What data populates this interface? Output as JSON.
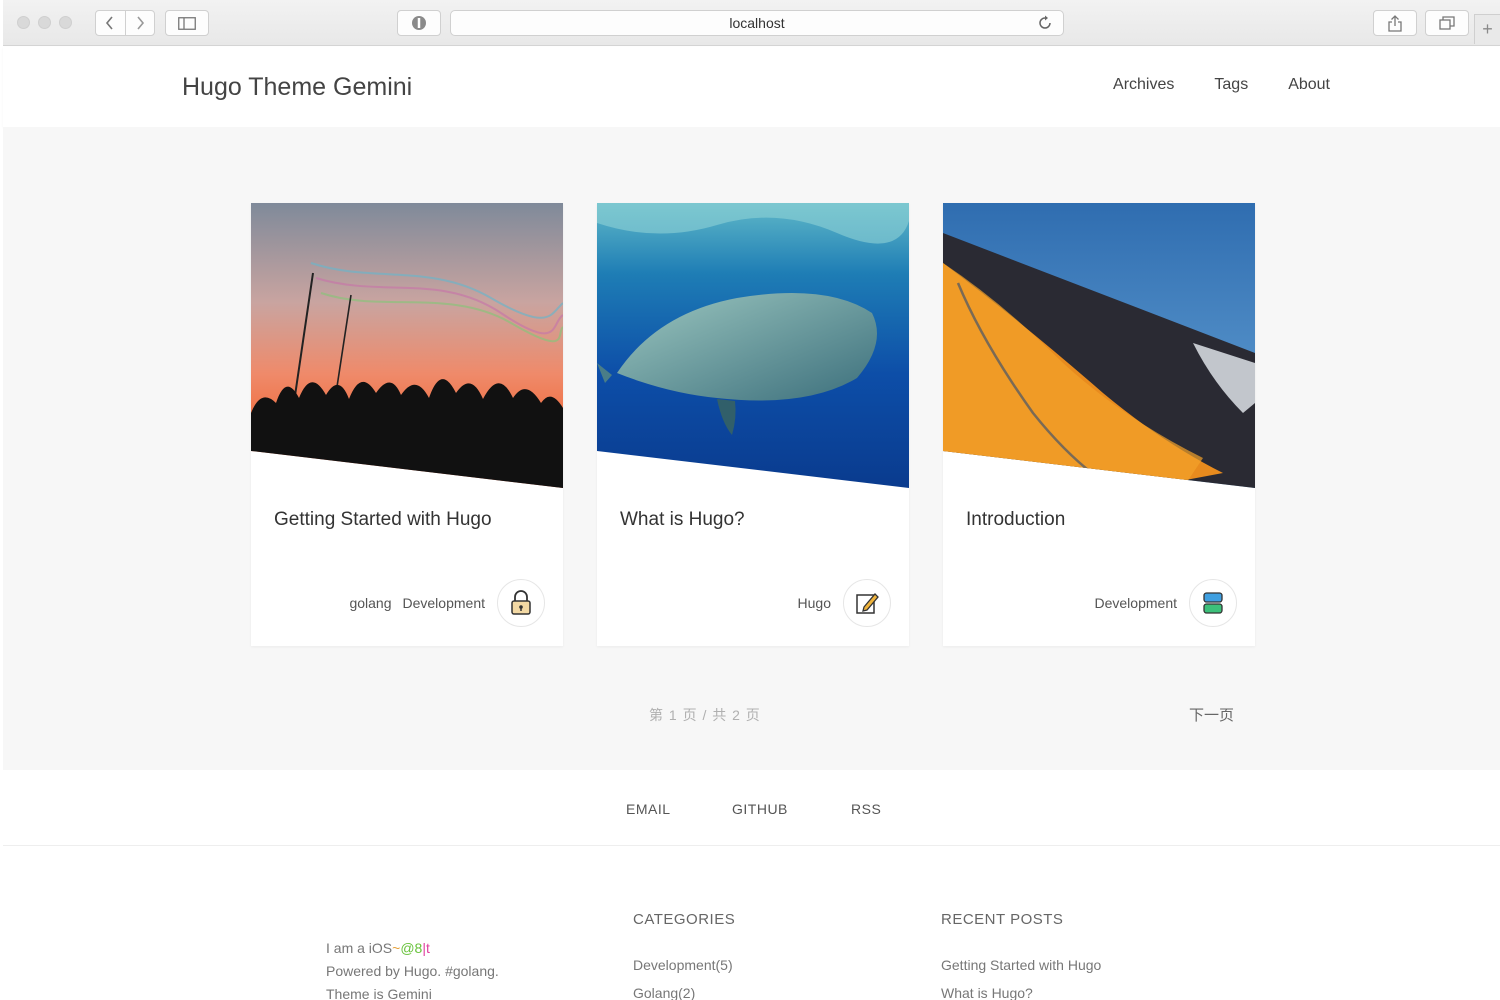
{
  "browser": {
    "address": "localhost"
  },
  "site": {
    "title": "Hugo Theme Gemini",
    "menu": [
      "Archives",
      "Tags",
      "About"
    ]
  },
  "posts": [
    {
      "title": "Getting Started with Hugo",
      "tags": [
        "golang",
        "Development"
      ],
      "icon": "lock-icon"
    },
    {
      "title": "What is Hugo?",
      "tags": [
        "Hugo"
      ],
      "icon": "edit-icon"
    },
    {
      "title": "Introduction",
      "tags": [
        "Development"
      ],
      "icon": "stack-icon"
    }
  ],
  "pagination": {
    "info": "第 1 页 / 共 2 页",
    "next": "下一页"
  },
  "social": [
    "EMAIL",
    "GITHUB",
    "RSS"
  ],
  "footer": {
    "about": {
      "line1_prefix": "I am a iOS",
      "line1_hl1": "~",
      "line1_hl2": "@8",
      "line1_hl3": "|t",
      "line2": "Powered by Hugo. #golang.",
      "line3": "Theme is Gemini"
    },
    "categories": {
      "title": "CATEGORIES",
      "items": [
        "Development(5)",
        "Golang(2)"
      ]
    },
    "recent": {
      "title": "RECENT POSTS",
      "items": [
        "Getting Started with Hugo",
        "What is Hugo?"
      ]
    }
  },
  "colors": {
    "accent_orange": "#e6a23c",
    "accent_green": "#67c23a",
    "accent_pink": "#e040a0"
  }
}
